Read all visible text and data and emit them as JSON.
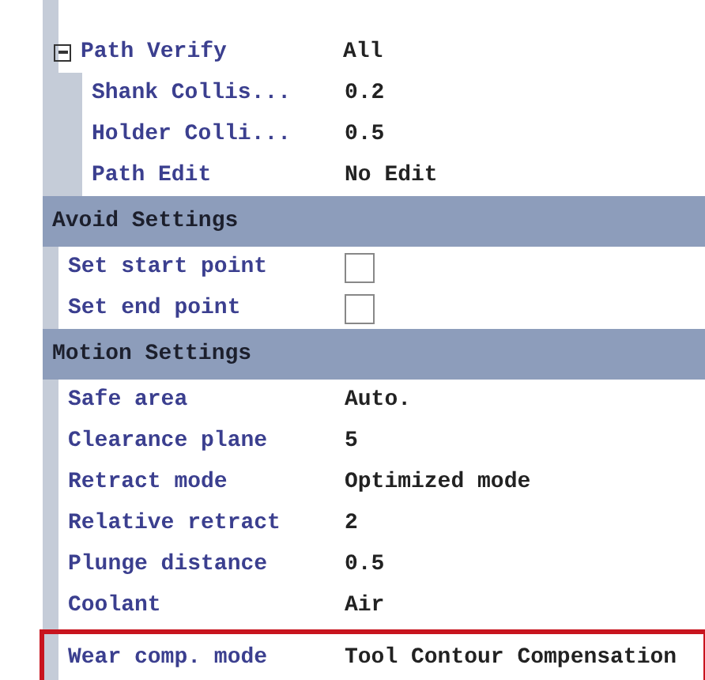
{
  "property_grid": {
    "items": [
      {
        "kind": "property",
        "name": "Path Verify",
        "value": "All",
        "expanded": true,
        "children": [
          {
            "kind": "property",
            "name": "Shank Collis...",
            "value": "0.2"
          },
          {
            "kind": "property",
            "name": "Holder Colli...",
            "value": "0.5"
          },
          {
            "kind": "property",
            "name": "Path Edit",
            "value": "No Edit"
          }
        ]
      },
      {
        "kind": "category",
        "name": "Avoid Settings"
      },
      {
        "kind": "checkbox",
        "name": "Set start point",
        "checked": false
      },
      {
        "kind": "checkbox",
        "name": "Set end point",
        "checked": false
      },
      {
        "kind": "category",
        "name": "Motion Settings"
      },
      {
        "kind": "property",
        "name": "Safe area",
        "value": "Auto."
      },
      {
        "kind": "property",
        "name": "Clearance plane",
        "value": "5"
      },
      {
        "kind": "property",
        "name": "Retract mode",
        "value": "Optimized mode"
      },
      {
        "kind": "property",
        "name": "Relative retract",
        "value": "2"
      },
      {
        "kind": "property",
        "name": "Plunge distance",
        "value": "0.5"
      },
      {
        "kind": "property",
        "name": "Coolant",
        "value": "Air"
      },
      {
        "kind": "property",
        "name": "Wear comp. mode",
        "value": "Tool Contour Compensation",
        "highlighted": true
      }
    ]
  }
}
